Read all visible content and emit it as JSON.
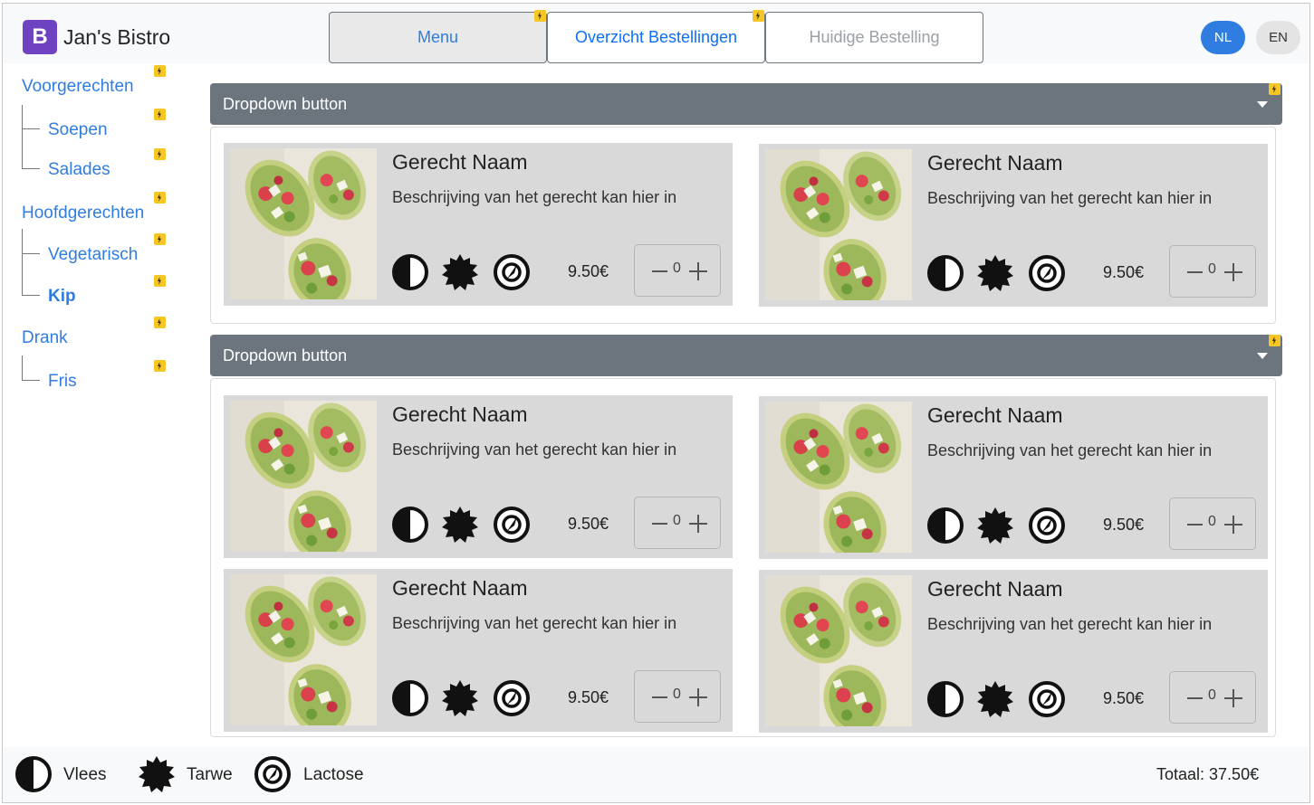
{
  "header": {
    "logo_letter": "B",
    "brand": "Jan's Bistro",
    "nav": [
      {
        "label": "Menu",
        "state": "active"
      },
      {
        "label": "Overzicht Bestellingen",
        "state": "normal"
      },
      {
        "label": "Huidige Bestelling",
        "state": "disabled"
      }
    ],
    "languages": [
      "NL",
      "EN"
    ],
    "active_language": "NL"
  },
  "sidebar": {
    "items": [
      {
        "label": "Voorgerechten"
      },
      {
        "label": "Soepen"
      },
      {
        "label": "Salades"
      },
      {
        "label": "Hoofdgerechten"
      },
      {
        "label": "Vegetarisch"
      },
      {
        "label": "Kip"
      },
      {
        "label": "Drank"
      },
      {
        "label": "Fris"
      }
    ],
    "active_item": "Kip"
  },
  "sections": [
    {
      "dropdown_label": "Dropdown button"
    },
    {
      "dropdown_label": "Dropdown button"
    }
  ],
  "dish": {
    "title": "Gerecht Naam",
    "description": "Beschrijving van het gerecht kan hier in",
    "price": "9.50€",
    "quantity": "0",
    "allergen_icons": [
      "vlees-icon",
      "tarwe-icon",
      "lactose-icon"
    ]
  },
  "footer": {
    "legend": [
      {
        "icon": "vlees-icon",
        "label": "Vlees"
      },
      {
        "icon": "tarwe-icon",
        "label": "Tarwe"
      },
      {
        "icon": "lactose-icon",
        "label": "Lactose"
      }
    ],
    "total": "Totaal: 37.50€"
  },
  "colors": {
    "primary": "#2f7de1",
    "dropdown": "#6c757d",
    "card": "#d9d9d9",
    "logo": "#6f42c1",
    "bolt": "#f6c624"
  }
}
